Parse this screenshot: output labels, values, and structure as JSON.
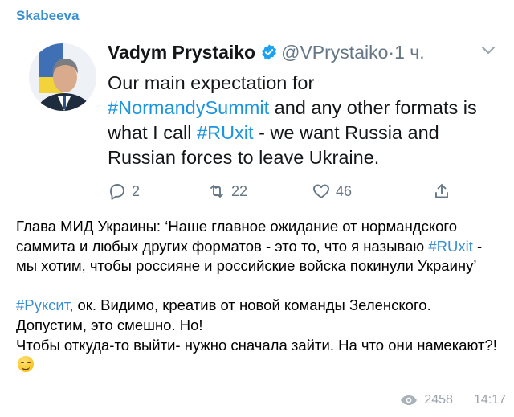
{
  "channel": {
    "name": "Skabeeva"
  },
  "tweet": {
    "author_name": "Vadym Prystaiko",
    "handle": "@VPrystaiko",
    "separator": "·",
    "time": "1 ч.",
    "text_parts": {
      "p1": "Our main expectation for",
      "tag1": "#NormandySummit",
      "p2": " and any other formats is what I call ",
      "tag2": "#RUxit",
      "p3": " -  we want Russia and Russian forces to leave Ukraine."
    },
    "replies": "2",
    "retweets": "22",
    "likes": "46"
  },
  "message": {
    "para1_a": "Глава МИД Украины: ‘Наше главное ожидание от нормандского саммита и любых других форматов - это то, что я называю ",
    "para1_tag": "#RUxit",
    "para1_b": " - мы хотим, чтобы россияне и российские войска покинули Украину’",
    "para2_tag": "#Руксит",
    "para2_a": ", ок. Видимо, креатив от новой команды Зеленского.",
    "para2_b": "Допустим, это смешно. Но!",
    "para2_c": "Чтобы откуда-то выйти- нужно сначала зайти. На что они намекают?!"
  },
  "meta": {
    "views": "2458",
    "time": "14:17"
  },
  "colors": {
    "link": "#1b95e0",
    "channel": "#3a8fd0",
    "muted": "#657786"
  }
}
